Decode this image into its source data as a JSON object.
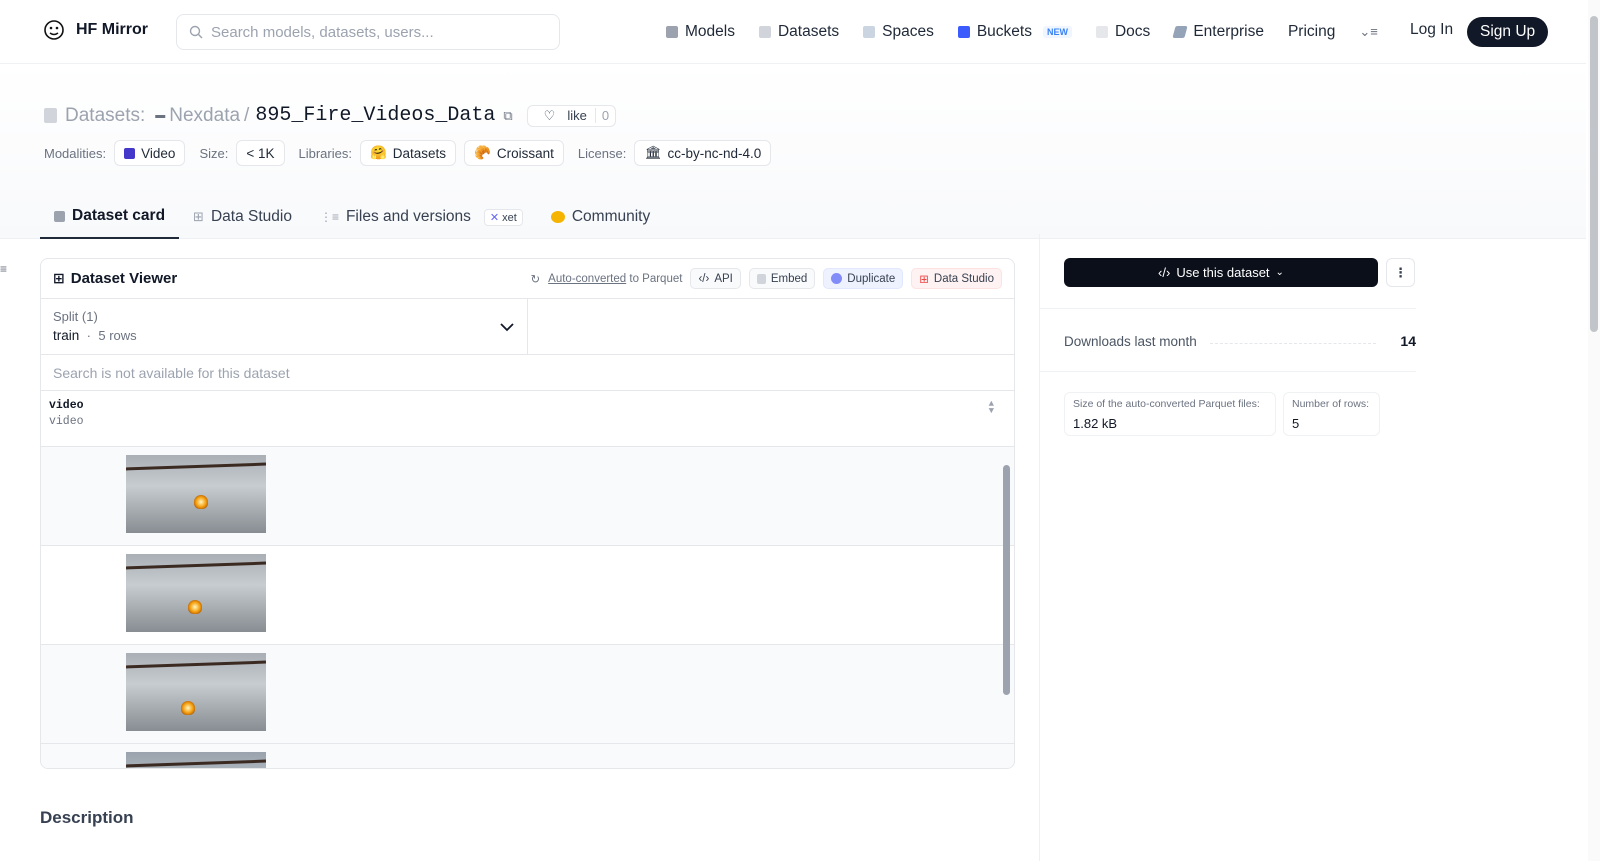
{
  "nav": {
    "brand": "HF Mirror",
    "search_placeholder": "Search models, datasets, users...",
    "links": [
      "Models",
      "Datasets",
      "Spaces",
      "Buckets",
      "Docs",
      "Enterprise",
      "Pricing"
    ],
    "new_badge": "NEW",
    "login": "Log In",
    "signup": "Sign Up"
  },
  "header": {
    "section": "Datasets:",
    "org": "Nexdata",
    "separator": "/",
    "name": "895_Fire_Videos_Data",
    "like_label": "like",
    "like_count": "0"
  },
  "tags": {
    "modalities_label": "Modalities:",
    "modality": "Video",
    "size_label": "Size:",
    "size": "< 1K",
    "libraries_label": "Libraries:",
    "lib1": "Datasets",
    "lib2": "Croissant",
    "license_label": "License:",
    "license": "cc-by-nc-nd-4.0"
  },
  "tabs": {
    "card": "Dataset card",
    "studio": "Data Studio",
    "files": "Files and versions",
    "xet": "xet",
    "community": "Community"
  },
  "viewer": {
    "title": "Dataset Viewer",
    "auto_pre": "Auto-converted",
    "auto_post": "to Parquet",
    "api": "API",
    "embed": "Embed",
    "duplicate": "Duplicate",
    "studio": "Data Studio",
    "split_label": "Split (1)",
    "split_name": "train",
    "split_rows": "5 rows",
    "search_na": "Search is not available for this dataset",
    "col_name": "video",
    "col_type": "video"
  },
  "sidebar": {
    "use_btn": "Use this dataset",
    "downloads_label": "Downloads last month",
    "downloads_value": "14",
    "parquet_label": "Size of the auto-converted Parquet files:",
    "parquet_value": "1.82 kB",
    "rows_label": "Number of rows:",
    "rows_value": "5"
  },
  "description_heading": "Description"
}
